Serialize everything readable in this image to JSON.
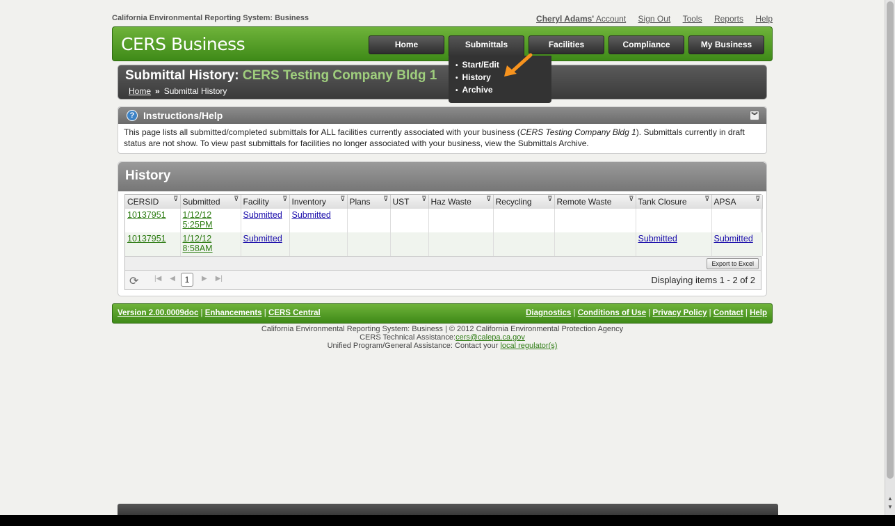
{
  "top": {
    "system_title": "California Environmental Reporting System: Business",
    "user_name": "Cheryl Adams'",
    "account_label": "Account",
    "links": [
      "Sign Out",
      "Tools",
      "Reports",
      "Help"
    ]
  },
  "header": {
    "brand": "CERS Business",
    "nav": [
      "Home",
      "Submittals",
      "Facilities",
      "Compliance",
      "My Business"
    ],
    "active": "Submittals",
    "dropdown": [
      "Start/Edit",
      "History",
      "Archive"
    ]
  },
  "title": {
    "prefix": "Submittal History:",
    "company": "CERS Testing Company Bldg 1",
    "crumb_home": "Home",
    "crumb_sep": "»",
    "crumb_current": "Submittal History"
  },
  "instructions": {
    "heading": "Instructions/Help",
    "text_before": "This page lists all submitted/completed submittals for ALL facilities currently associated with your business (",
    "text_company": "CERS Testing Company Bldg 1",
    "text_after": "). Submittals currently in draft status are not show. To view past submittals for facilities no longer associated with your business, view the Submittals Archive."
  },
  "history": {
    "heading": "History",
    "columns": [
      "CERSID",
      "Submitted",
      "Facility",
      "Inventory",
      "Plans",
      "UST",
      "Haz Waste",
      "Recycling",
      "Remote Waste",
      "Tank Closure",
      "APSA"
    ],
    "rows": [
      {
        "cersid": "10137951",
        "date": "1/12/12",
        "time": "5:25PM",
        "facility": "Submitted",
        "inventory": "Submitted",
        "plans": "",
        "ust": "",
        "haz": "",
        "recycling": "",
        "remote": "",
        "tank": "",
        "apsa": ""
      },
      {
        "cersid": "10137951",
        "date": "1/12/12",
        "time": "8:58AM",
        "facility": "Submitted",
        "inventory": "",
        "plans": "",
        "ust": "",
        "haz": "",
        "recycling": "",
        "remote": "",
        "tank": "Submitted",
        "apsa": "Submitted"
      }
    ],
    "export_label": "Export to Excel",
    "current_page": "1",
    "display_info": "Displaying items 1 - 2 of 2"
  },
  "footer": {
    "version": "Version 2.00.0009doc",
    "enhancements": "Enhancements",
    "central": "CERS Central",
    "diagnostics": "Diagnostics",
    "conditions": "Conditions of Use",
    "privacy": "Privacy Policy",
    "contact": "Contact",
    "help": "Help",
    "copyright": "California Environmental Reporting System: Business | © 2012 California Environmental Protection Agency",
    "tech_label": "CERS Technical Assistance:",
    "tech_email": "cers@calepa.ca.gov",
    "unified_label": "Unified Program/General Assistance: Contact your",
    "regulator_link": "local regulator(s)"
  },
  "colors": {
    "brand_green": "#4f9a23",
    "dark_nav": "#333333",
    "arrow_orange": "#f7931e",
    "link_blue": "#1a0dab"
  }
}
